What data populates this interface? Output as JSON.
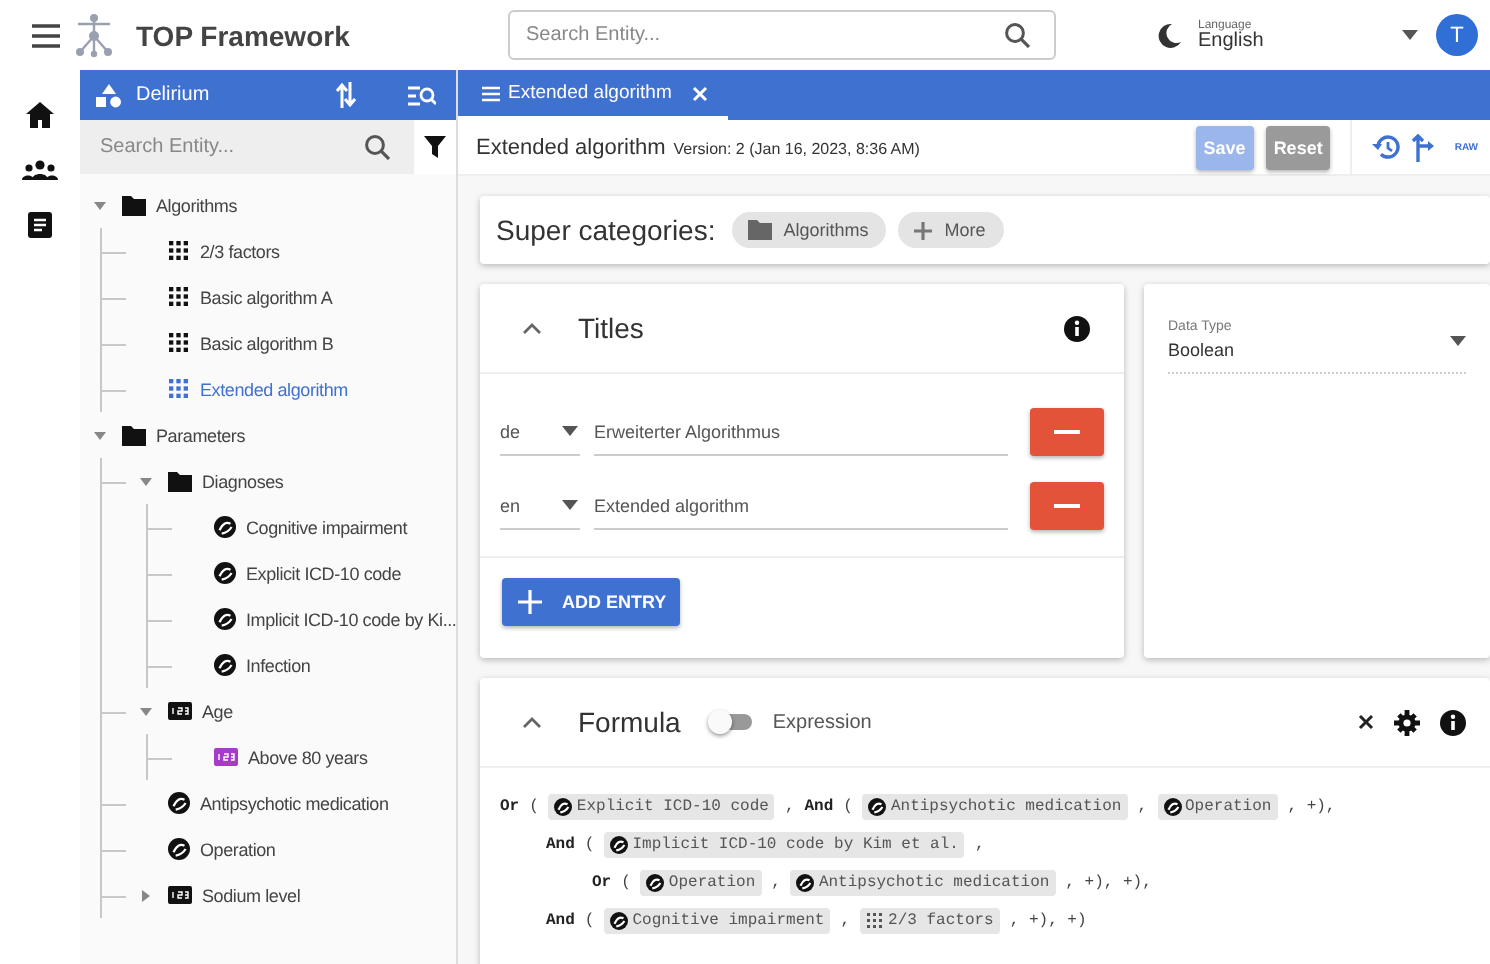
{
  "app": {
    "title": "TOP Framework",
    "search": {
      "placeholder": "Search Entity..."
    },
    "language": {
      "label": "Language",
      "value": "English"
    },
    "avatar": "T"
  },
  "sidebar": {
    "title": "Delirium",
    "search": {
      "placeholder": "Search Entity..."
    },
    "tree": [
      {
        "label": "Algorithms",
        "kind": "folder",
        "expanded": true,
        "selected": false,
        "children": [
          {
            "label": "2/3 factors",
            "kind": "algorithm",
            "selected": false
          },
          {
            "label": "Basic algorithm A",
            "kind": "algorithm",
            "selected": false
          },
          {
            "label": "Basic algorithm B",
            "kind": "algorithm",
            "selected": false
          },
          {
            "label": "Extended algorithm",
            "kind": "algorithm",
            "selected": true
          }
        ]
      },
      {
        "label": "Parameters",
        "kind": "folder",
        "expanded": true,
        "selected": false,
        "children": [
          {
            "label": "Diagnoses",
            "kind": "folder",
            "expanded": true,
            "selected": false,
            "children": [
              {
                "label": "Cognitive impairment",
                "kind": "diagnosis",
                "selected": false
              },
              {
                "label": "Explicit ICD-10 code",
                "kind": "diagnosis",
                "selected": false
              },
              {
                "label": "Implicit ICD-10 code by Ki...",
                "kind": "diagnosis",
                "selected": false
              },
              {
                "label": "Infection",
                "kind": "diagnosis",
                "selected": false
              }
            ]
          },
          {
            "label": "Age",
            "kind": "number",
            "expanded": true,
            "selected": false,
            "children": [
              {
                "label": "Above 80 years",
                "kind": "range",
                "selected": false
              }
            ]
          },
          {
            "label": "Antipsychotic medication",
            "kind": "diagnosis",
            "selected": false
          },
          {
            "label": "Operation",
            "kind": "diagnosis",
            "selected": false
          },
          {
            "label": "Sodium level",
            "kind": "number",
            "expanded": false,
            "selected": false
          }
        ]
      }
    ]
  },
  "tabs": [
    {
      "label": "Extended algorithm",
      "selected": true
    }
  ],
  "header": {
    "title": "Extended algorithm",
    "version": "Version: 2 (Jan 16, 2023, 8:36 AM)",
    "buttons": [
      {
        "label": "Save",
        "kind": "save",
        "disabled": true
      },
      {
        "label": "Reset",
        "kind": "reset",
        "disabled": true
      }
    ],
    "raw_button": "RAW"
  },
  "super_categories": {
    "label": "Super categories:",
    "chips": [
      {
        "label": "Algorithms",
        "kind": "category"
      },
      {
        "label": "More",
        "kind": "add"
      }
    ]
  },
  "titles": {
    "heading": "Titles",
    "entries": [
      {
        "language": "de",
        "value": "Erweiterter Algorithmus"
      },
      {
        "language": "en",
        "value": "Extended algorithm"
      }
    ],
    "add_button": "ADD ENTRY"
  },
  "data_type": {
    "label": "Data Type",
    "value": "Boolean"
  },
  "formula": {
    "heading": "Formula",
    "toggle": {
      "label": "Expression",
      "on": false
    },
    "lines": [
      {
        "tokens": [
          {
            "kind": "op",
            "text": "Or"
          },
          {
            "kind": "symbol",
            "text": "("
          },
          {
            "kind": "diagnosis",
            "text": "Explicit ICD-10 code"
          },
          {
            "kind": "symbol",
            "text": ","
          },
          {
            "kind": "op",
            "text": "And"
          },
          {
            "kind": "symbol",
            "text": "("
          },
          {
            "kind": "diagnosis",
            "text": "Antipsychotic medication"
          },
          {
            "kind": "symbol",
            "text": ","
          },
          {
            "kind": "diagnosis",
            "text": "Operation"
          },
          {
            "kind": "symbol",
            "text": ", +),"
          }
        ],
        "children": [
          {
            "tokens": [
              {
                "kind": "op",
                "text": "And"
              },
              {
                "kind": "symbol",
                "text": "("
              },
              {
                "kind": "diagnosis",
                "text": "Implicit ICD-10 code by Kim et al."
              },
              {
                "kind": "symbol",
                "text": ","
              }
            ],
            "children": [
              {
                "tokens": [
                  {
                    "kind": "op",
                    "text": "Or"
                  },
                  {
                    "kind": "symbol",
                    "text": "("
                  },
                  {
                    "kind": "diagnosis",
                    "text": "Operation"
                  },
                  {
                    "kind": "symbol",
                    "text": ","
                  },
                  {
                    "kind": "diagnosis",
                    "text": "Antipsychotic medication"
                  },
                  {
                    "kind": "symbol",
                    "text": ", +), +),"
                  }
                ]
              }
            ]
          },
          {
            "tokens": [
              {
                "kind": "op",
                "text": "And"
              },
              {
                "kind": "symbol",
                "text": "("
              },
              {
                "kind": "diagnosis",
                "text": "Cognitive impairment"
              },
              {
                "kind": "symbol",
                "text": ","
              },
              {
                "kind": "algorithm",
                "text": "2/3 factors"
              },
              {
                "kind": "symbol",
                "text": ", +), +)"
              }
            ]
          }
        ]
      }
    ]
  }
}
